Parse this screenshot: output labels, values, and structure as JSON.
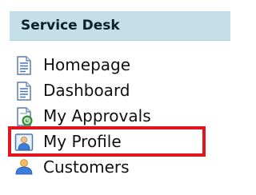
{
  "header": {
    "title": "Service Desk"
  },
  "nav": {
    "items": [
      {
        "label": "Homepage",
        "icon": "document-icon"
      },
      {
        "label": "Dashboard",
        "icon": "document-icon"
      },
      {
        "label": "My Approvals",
        "icon": "approval-document-icon"
      },
      {
        "label": "My Profile",
        "icon": "user-profile-icon",
        "highlighted": true
      },
      {
        "label": "Customers",
        "icon": "customers-icon"
      }
    ]
  },
  "colors": {
    "header_bg": "#c5dfe8",
    "highlight_border": "#e3141b"
  }
}
